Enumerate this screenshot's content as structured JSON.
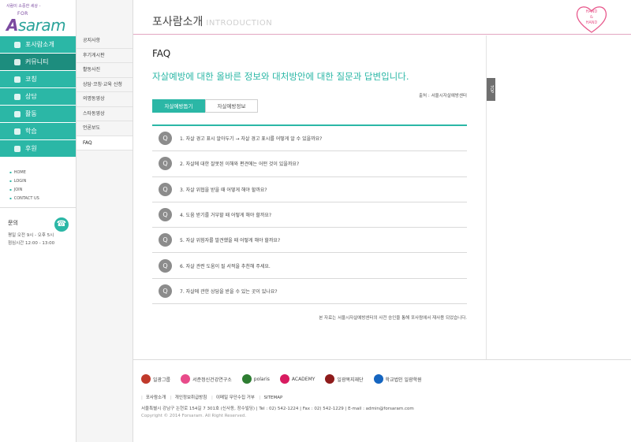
{
  "brand": {
    "slogan": "사람이 소중한 세상 -",
    "logo_for": "FOR",
    "logo_a": "A",
    "logo_word": "saram"
  },
  "main_menu": [
    {
      "label": "포사람소개",
      "icon": "info-icon"
    },
    {
      "label": "커뮤니티",
      "icon": "community-icon"
    },
    {
      "label": "코칭",
      "icon": "person-icon"
    },
    {
      "label": "상담",
      "icon": "counsel-icon"
    },
    {
      "label": "활동",
      "icon": "activity-icon"
    },
    {
      "label": "학습",
      "icon": "pen-icon"
    },
    {
      "label": "후원",
      "icon": "donate-icon"
    }
  ],
  "quick_links": [
    "HOME",
    "LOGIN",
    "JOIN",
    "CONTACT US"
  ],
  "contact": {
    "title": "문의",
    "hours": "평일 오전 9시 - 오후 5시",
    "lunch": "점심시간 12:00 - 13:00"
  },
  "sub_menu": [
    "공지사항",
    "후기게시판",
    "활동사진",
    "상담·코칭·교육 신청",
    "의명동영상",
    "스타동영상",
    "언론보도",
    "FAQ"
  ],
  "header": {
    "title": "포사람소개",
    "title_en": "INTRODUCTION",
    "badge_line1": "HAND",
    "badge_line2": "&",
    "badge_line3": "HAND"
  },
  "content": {
    "page_title": "FAQ",
    "headline": "자살예방에 대한 올바른 정보와 대처방안에 대한 질문과 답변입니다.",
    "source": "출처 : 서울시자살예방센터",
    "tabs": [
      "자살예방돕기",
      "자살예방정보"
    ],
    "questions": [
      "1. 자살 경고 표시 알아두기 → 자살 경고 표시를 어떻게 알 수 있을까요?",
      "2. 자살에 대한 잘못된 이해와 편견에는 어떤 것이 있을까요?",
      "3. 자살 위협을 받을 때 어떻게 해야 할까요?",
      "4. 도움 받기를 거부할 때 어떻게 해야 할까요?",
      "5. 자살 위험자를 발견했을 때 어떻게 해야 할까요?",
      "6. 자살 관련 도움이 될 서적을 추천해 주세요.",
      "7. 자살에 관한 상담을 받을 수 있는 곳이 있나요?"
    ],
    "notice": "본 자료는 서울시자살예방센터의 사전 승인을 통해 포사람에서 재사용 되었습니다.",
    "top_button": "TOP"
  },
  "footer": {
    "partners": [
      {
        "name": "일광그룹",
        "color": "#c0392b"
      },
      {
        "name": "서준정신건강연구소",
        "color": "#e84b8a"
      },
      {
        "name": "polaris",
        "color": "#2e7d32"
      },
      {
        "name": "ACADEMY",
        "color": "#d81b60"
      },
      {
        "name": "일광복지재단",
        "color": "#8e1b1b"
      },
      {
        "name": "학교법인 일광학원",
        "color": "#1565c0"
      }
    ],
    "links": [
      "포사람소개",
      "개인정보취급방침",
      "이메일 무단수집 거부",
      "SITEMAP"
    ],
    "address": "서울특별시 강남구 논현로 154길 7 301호 (신사동, 장수빌딩)  |  Tel : 02) 542-1224  |  Fax : 02) 542-1229  |  E-mail : admin@forsaram.com",
    "copyright": "Copyright © 2014 Forsaram. All Right Reserved."
  },
  "colors": {
    "accent": "#2bb7a6",
    "accent_dark": "#1d8d7e",
    "heart": "#e85a8d",
    "brand_purple": "#7b4aa0"
  }
}
